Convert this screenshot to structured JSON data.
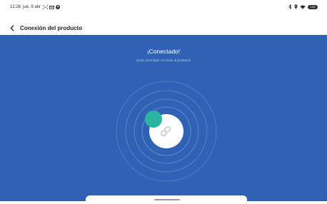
{
  "status_bar": {
    "time": "12:26",
    "date": "jue, 9 abr",
    "battery_level": "100"
  },
  "header": {
    "title": "Conexión del producto"
  },
  "main": {
    "heading": "¡Conectado!",
    "subheading": "¡Está conectado con éxito al producto!"
  },
  "colors": {
    "background_blue": "#2F62B5",
    "accent_teal": "#2BB5A0"
  },
  "icons": {
    "back": "chevron-left-icon",
    "connected": "link-icon"
  }
}
